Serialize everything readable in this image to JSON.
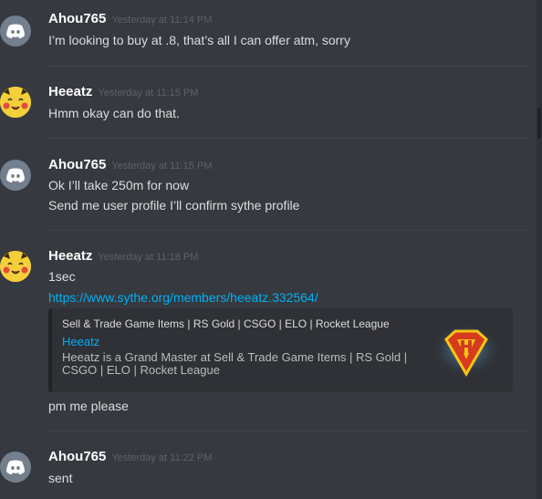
{
  "messages": [
    {
      "username": "Ahou765",
      "timestamp": "Yesterday at 11:14 PM",
      "avatar": "discord-logo-icon",
      "lines": [
        "I’m looking to buy at .8, that’s all I can offer atm, sorry"
      ]
    },
    {
      "username": "Heeatz",
      "timestamp": "Yesterday at 11:15 PM",
      "avatar": "pikachu-avatar",
      "lines": [
        "Hmm okay can do that."
      ]
    },
    {
      "username": "Ahou765",
      "timestamp": "Yesterday at 11:15 PM",
      "avatar": "discord-logo-icon",
      "lines": [
        "Ok I’ll take 250m for now",
        "Send me user profile I’ll confirm sythe profile"
      ]
    },
    {
      "username": "Heeatz",
      "timestamp": "Yesterday at 11:18 PM",
      "avatar": "pikachu-avatar",
      "lines": [
        "1sec"
      ],
      "link": "https://www.sythe.org/members/heeatz.332564/",
      "embed": {
        "provider": "Sell & Trade Game Items | RS Gold | CSGO | ELO | Rocket League",
        "title": "Heeatz",
        "description": "Heeatz is a Grand Master at Sell & Trade Game Items | RS Gold | CSGO | ELO | Rocket League",
        "thumbnail": "superman-shield-icon"
      },
      "after_lines": [
        "pm me please"
      ]
    },
    {
      "username": "Ahou765",
      "timestamp": "Yesterday at 11:22 PM",
      "avatar": "discord-logo-icon",
      "lines": [
        "sent"
      ]
    }
  ],
  "colors": {
    "background": "#36393f",
    "username": "#ffffff",
    "timestamp": "#5e6166",
    "text": "#dcddde",
    "link": "#00b0f4",
    "embed_bg": "#2f3136"
  }
}
